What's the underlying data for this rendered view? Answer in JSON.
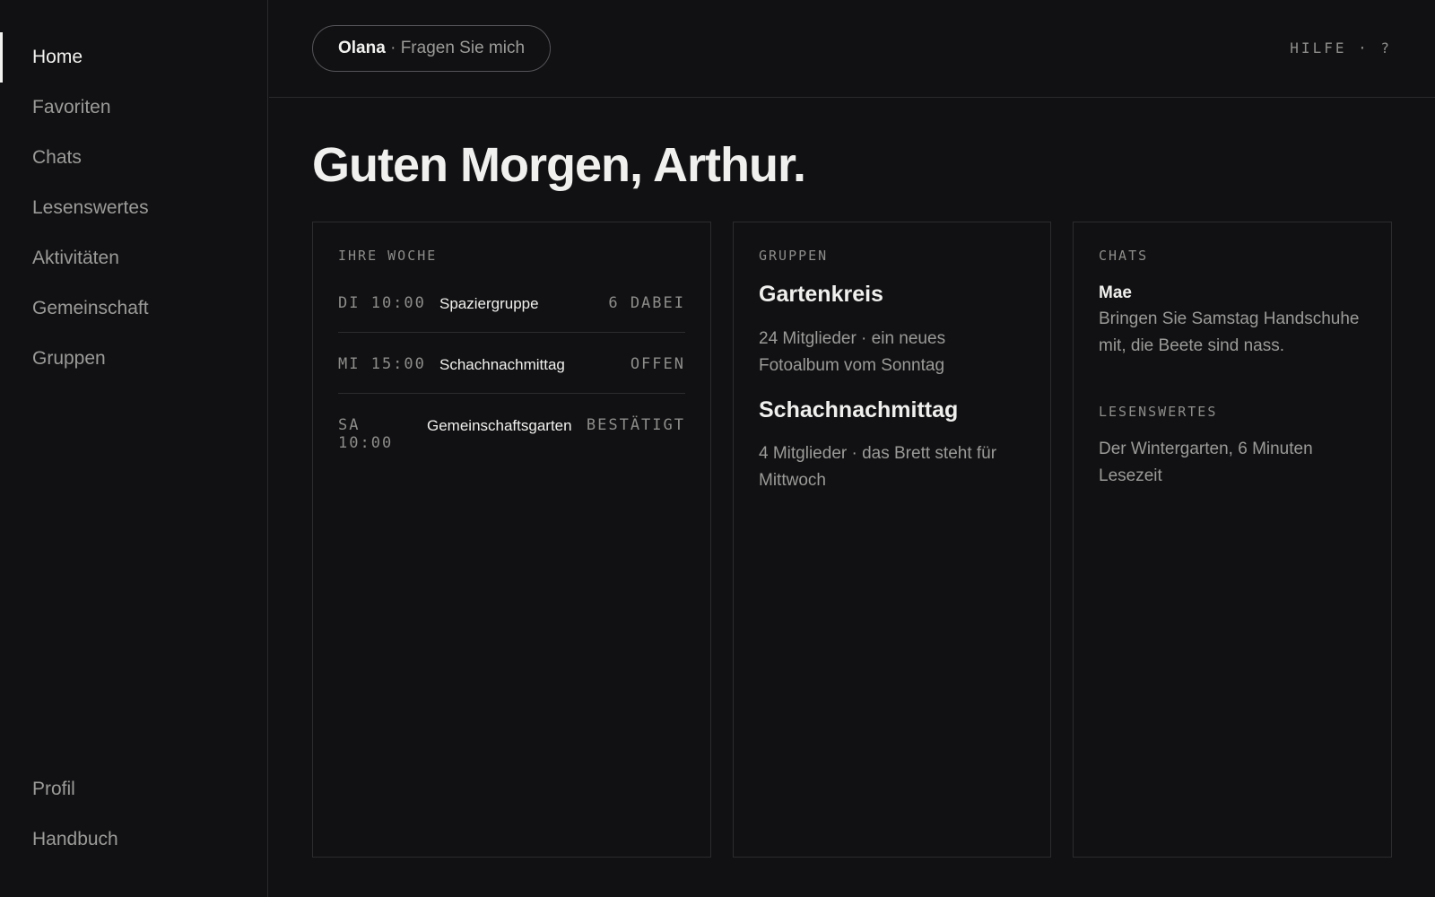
{
  "sidebar": {
    "items": [
      {
        "label": "Home"
      },
      {
        "label": "Favoriten"
      },
      {
        "label": "Chats"
      },
      {
        "label": "Lesenswertes"
      },
      {
        "label": "Aktivitäten"
      },
      {
        "label": "Gemeinschaft"
      },
      {
        "label": "Gruppen"
      }
    ],
    "active": "Home",
    "bottom_items": [
      {
        "label": "Profil"
      },
      {
        "label": "Handbuch"
      }
    ]
  },
  "header": {
    "assistant_name": "Olana",
    "assistant_prompt": " · Fragen Sie mich",
    "help_label": "HILFE · ?"
  },
  "main": {
    "greeting": "Guten Morgen, Arthur.",
    "week": {
      "label": "IHRE WOCHE",
      "rows": [
        {
          "time": "DI 10:00",
          "title": "Spaziergruppe",
          "status": "6 DABEI"
        },
        {
          "time": "MI 15:00",
          "title": "Schachnachmittag",
          "status": "OFFEN"
        },
        {
          "time": "SA\n10:00",
          "title": "Gemeinschaftsgarten",
          "status": "BESTÄTIGT"
        }
      ]
    },
    "groups": {
      "label": "GRUPPEN",
      "items": [
        {
          "name": "Gartenkreis",
          "details": "24 Mitglieder · ein neues Fotoalbum vom Sonntag"
        },
        {
          "name": "Schachnachmittag",
          "details": "4 Mitglieder · das Brett steht für Mittwoch"
        }
      ]
    },
    "chats": {
      "label": "CHATS",
      "sender": "Mae",
      "message": "Bringen Sie Samstag Handschuhe mit, die Beete sind nass."
    },
    "reading": {
      "label": "LESENSWERTES",
      "item": "Der Wintergarten, 6 Minuten Lesezeit"
    }
  },
  "colors": {
    "background": "#111113",
    "text_primary": "#f0f0ee",
    "text_muted": "#9b9b99",
    "border": "#2c2c2f"
  }
}
